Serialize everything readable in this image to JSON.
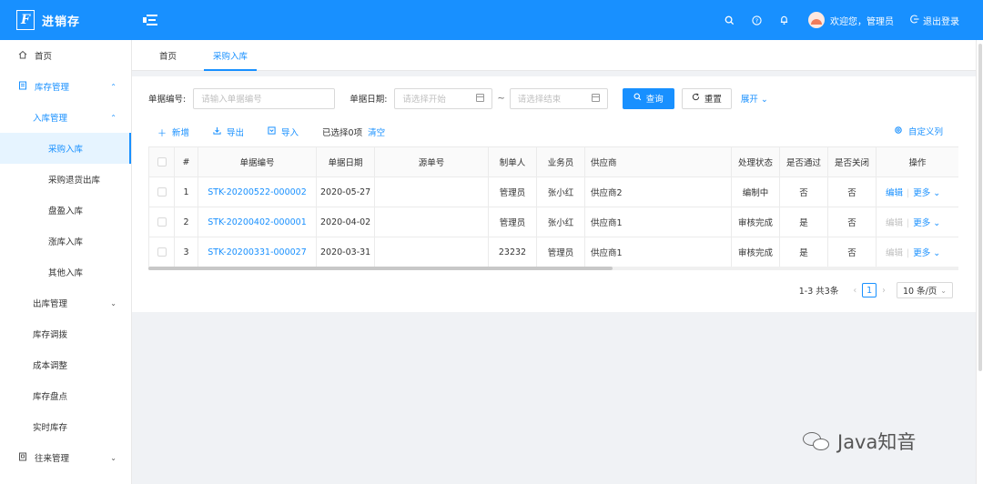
{
  "app": {
    "logo_mark": "F",
    "title": "进销存"
  },
  "header": {
    "welcome": "欢迎您，管理员",
    "logout": "退出登录",
    "icons": [
      "search-icon",
      "help-icon",
      "bell-icon"
    ]
  },
  "sidebar": {
    "items": [
      {
        "label": "首页",
        "icon": "home-icon"
      },
      {
        "label": "库存管理",
        "icon": "document-icon"
      },
      {
        "label": "入库管理"
      },
      {
        "label": "采购入库"
      },
      {
        "label": "采购退货出库"
      },
      {
        "label": "盘盈入库"
      },
      {
        "label": "涨库入库"
      },
      {
        "label": "其他入库"
      },
      {
        "label": "出库管理"
      },
      {
        "label": "库存调拨"
      },
      {
        "label": "成本调整"
      },
      {
        "label": "库存盘点"
      },
      {
        "label": "实时库存"
      },
      {
        "label": "往来管理",
        "icon": "ledger-icon"
      }
    ]
  },
  "tabs": [
    {
      "label": "首页"
    },
    {
      "label": "采购入库"
    }
  ],
  "search": {
    "code_label": "单据编号:",
    "code_placeholder": "请输入单据编号",
    "date_label": "单据日期:",
    "date_start_placeholder": "请选择开始",
    "date_end_placeholder": "请选择结束",
    "tilde": "~",
    "query": "查询",
    "reset": "重置",
    "expand": "展开"
  },
  "toolbar": {
    "add": "新增",
    "export": "导出",
    "import": "导入",
    "selected": "已选择0项",
    "clear": "清空",
    "custom_columns": "自定义列"
  },
  "table": {
    "columns": [
      "#",
      "单据编号",
      "单据日期",
      "源单号",
      "制单人",
      "业务员",
      "供应商",
      "处理状态",
      "是否通过",
      "是否关闭",
      "操作"
    ],
    "rows": [
      {
        "num": "1",
        "code": "STK-20200522-000002",
        "date": "2020-05-27",
        "source": "",
        "maker": "管理员",
        "salesman": "张小红",
        "supplier": "供应商2",
        "status": "编制中",
        "passed": "否",
        "closed": "否",
        "edit": "编辑",
        "more": "更多"
      },
      {
        "num": "2",
        "code": "STK-20200402-000001",
        "date": "2020-04-02",
        "source": "",
        "maker": "管理员",
        "salesman": "张小红",
        "supplier": "供应商1",
        "status": "审核完成",
        "passed": "是",
        "closed": "否",
        "edit": "编辑",
        "more": "更多"
      },
      {
        "num": "3",
        "code": "STK-20200331-000027",
        "date": "2020-03-31",
        "source": "",
        "maker": "23232",
        "salesman": "管理员",
        "supplier": "供应商1",
        "status": "审核完成",
        "passed": "是",
        "closed": "否",
        "edit": "编辑",
        "more": "更多"
      }
    ]
  },
  "pagination": {
    "total": "1-3 共3条",
    "current": "1",
    "page_size": "10 条/页"
  },
  "watermark": {
    "text": "Java知音"
  },
  "colors": {
    "primary": "#1890ff",
    "background": "#f0f2f5"
  }
}
